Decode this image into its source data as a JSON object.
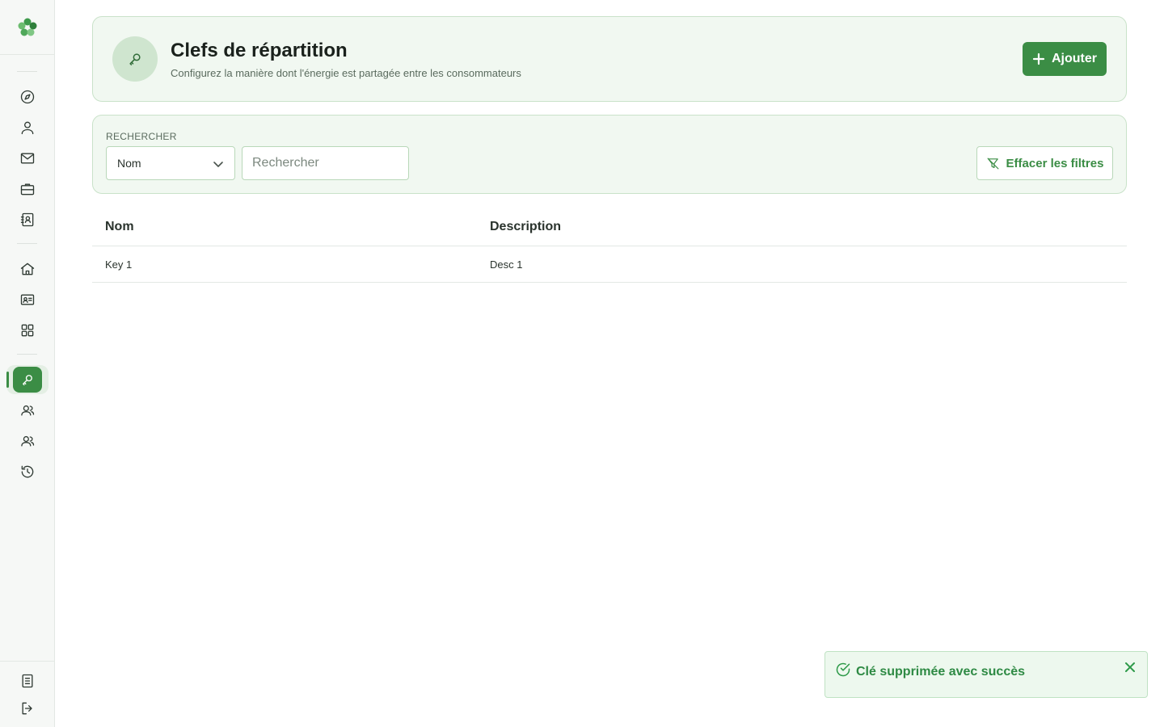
{
  "sidebar": {
    "items": [
      {
        "name": "compass-icon"
      },
      {
        "name": "user-icon"
      },
      {
        "name": "mail-icon"
      },
      {
        "name": "briefcase-icon"
      },
      {
        "name": "contact-book-icon"
      },
      {
        "name": "home-icon"
      },
      {
        "name": "id-card-icon"
      },
      {
        "name": "grid-icon"
      },
      {
        "name": "key-icon",
        "active": true
      },
      {
        "name": "users-icon"
      },
      {
        "name": "users-group-icon"
      },
      {
        "name": "history-icon"
      },
      {
        "name": "document-icon"
      },
      {
        "name": "logout-icon"
      }
    ]
  },
  "header": {
    "title": "Clefs de répartition",
    "subtitle": "Configurez la manière dont l'énergie est partagée entre les consommateurs",
    "add_label": "Ajouter"
  },
  "filters": {
    "label": "RECHERCHER",
    "field_selected": "Nom",
    "search_placeholder": "Rechercher",
    "search_value": "",
    "clear_label": "Effacer les filtres"
  },
  "table": {
    "columns": [
      "Nom",
      "Description"
    ],
    "rows": [
      {
        "nom": "Key 1",
        "description": "Desc 1"
      }
    ]
  },
  "toast": {
    "message": "Clé supprimée avec succès",
    "status": "success"
  },
  "colors": {
    "accent": "#3b8d45",
    "card_bg": "#f1f8f1",
    "card_border": "#c9e2c9",
    "toast_text": "#2e8a44"
  }
}
